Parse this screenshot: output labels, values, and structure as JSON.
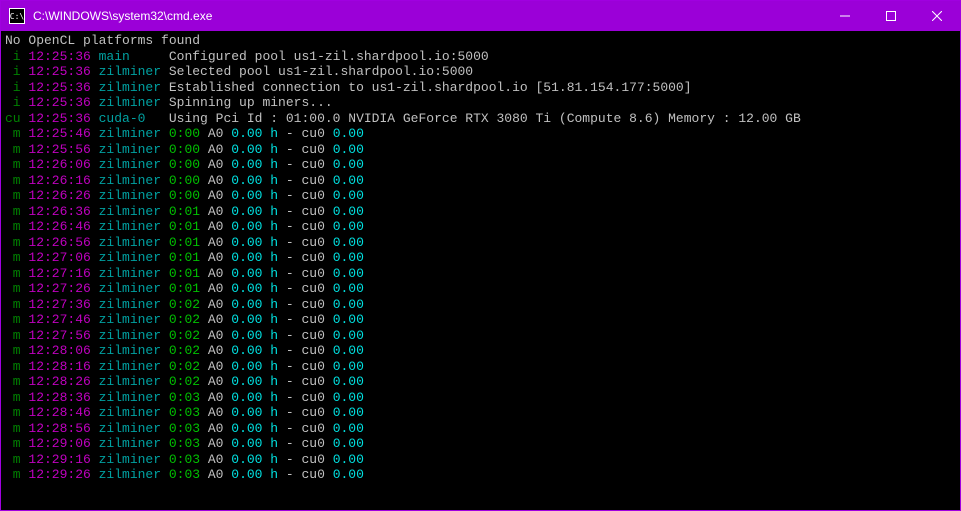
{
  "window": {
    "title": "C:\\WINDOWS\\system32\\cmd.exe",
    "icon_label": "C:\\"
  },
  "intro_line": "No OpenCL platforms found",
  "header_lines": [
    {
      "tag": "i",
      "time": "12:25:36",
      "source": "main",
      "text": "Configured pool us1-zil.shardpool.io:5000"
    },
    {
      "tag": "i",
      "time": "12:25:36",
      "source": "zilminer",
      "text": "Selected pool us1-zil.shardpool.io:5000"
    },
    {
      "tag": "i",
      "time": "12:25:36",
      "source": "zilminer",
      "text": "Established connection to us1-zil.shardpool.io [51.81.154.177:5000]"
    },
    {
      "tag": "i",
      "time": "12:25:36",
      "source": "zilminer",
      "text": "Spinning up miners..."
    }
  ],
  "cuda_line": {
    "tag": "cu",
    "time": "12:25:36",
    "source": "cuda-0",
    "text": "Using Pci Id : 01:00.0 NVIDIA GeForce RTX 3080 Ti (Compute 8.6) Memory : 12.00 GB"
  },
  "miner_lines": [
    {
      "tag": "m",
      "time": "12:25:46",
      "source": "zilminer",
      "elapsed": "0:00",
      "a": "A0",
      "rate": "0.00 h",
      "sep": "-",
      "dev": "cu0",
      "devrate": "0.00"
    },
    {
      "tag": "m",
      "time": "12:25:56",
      "source": "zilminer",
      "elapsed": "0:00",
      "a": "A0",
      "rate": "0.00 h",
      "sep": "-",
      "dev": "cu0",
      "devrate": "0.00"
    },
    {
      "tag": "m",
      "time": "12:26:06",
      "source": "zilminer",
      "elapsed": "0:00",
      "a": "A0",
      "rate": "0.00 h",
      "sep": "-",
      "dev": "cu0",
      "devrate": "0.00"
    },
    {
      "tag": "m",
      "time": "12:26:16",
      "source": "zilminer",
      "elapsed": "0:00",
      "a": "A0",
      "rate": "0.00 h",
      "sep": "-",
      "dev": "cu0",
      "devrate": "0.00"
    },
    {
      "tag": "m",
      "time": "12:26:26",
      "source": "zilminer",
      "elapsed": "0:00",
      "a": "A0",
      "rate": "0.00 h",
      "sep": "-",
      "dev": "cu0",
      "devrate": "0.00"
    },
    {
      "tag": "m",
      "time": "12:26:36",
      "source": "zilminer",
      "elapsed": "0:01",
      "a": "A0",
      "rate": "0.00 h",
      "sep": "-",
      "dev": "cu0",
      "devrate": "0.00"
    },
    {
      "tag": "m",
      "time": "12:26:46",
      "source": "zilminer",
      "elapsed": "0:01",
      "a": "A0",
      "rate": "0.00 h",
      "sep": "-",
      "dev": "cu0",
      "devrate": "0.00"
    },
    {
      "tag": "m",
      "time": "12:26:56",
      "source": "zilminer",
      "elapsed": "0:01",
      "a": "A0",
      "rate": "0.00 h",
      "sep": "-",
      "dev": "cu0",
      "devrate": "0.00"
    },
    {
      "tag": "m",
      "time": "12:27:06",
      "source": "zilminer",
      "elapsed": "0:01",
      "a": "A0",
      "rate": "0.00 h",
      "sep": "-",
      "dev": "cu0",
      "devrate": "0.00"
    },
    {
      "tag": "m",
      "time": "12:27:16",
      "source": "zilminer",
      "elapsed": "0:01",
      "a": "A0",
      "rate": "0.00 h",
      "sep": "-",
      "dev": "cu0",
      "devrate": "0.00"
    },
    {
      "tag": "m",
      "time": "12:27:26",
      "source": "zilminer",
      "elapsed": "0:01",
      "a": "A0",
      "rate": "0.00 h",
      "sep": "-",
      "dev": "cu0",
      "devrate": "0.00"
    },
    {
      "tag": "m",
      "time": "12:27:36",
      "source": "zilminer",
      "elapsed": "0:02",
      "a": "A0",
      "rate": "0.00 h",
      "sep": "-",
      "dev": "cu0",
      "devrate": "0.00"
    },
    {
      "tag": "m",
      "time": "12:27:46",
      "source": "zilminer",
      "elapsed": "0:02",
      "a": "A0",
      "rate": "0.00 h",
      "sep": "-",
      "dev": "cu0",
      "devrate": "0.00"
    },
    {
      "tag": "m",
      "time": "12:27:56",
      "source": "zilminer",
      "elapsed": "0:02",
      "a": "A0",
      "rate": "0.00 h",
      "sep": "-",
      "dev": "cu0",
      "devrate": "0.00"
    },
    {
      "tag": "m",
      "time": "12:28:06",
      "source": "zilminer",
      "elapsed": "0:02",
      "a": "A0",
      "rate": "0.00 h",
      "sep": "-",
      "dev": "cu0",
      "devrate": "0.00"
    },
    {
      "tag": "m",
      "time": "12:28:16",
      "source": "zilminer",
      "elapsed": "0:02",
      "a": "A0",
      "rate": "0.00 h",
      "sep": "-",
      "dev": "cu0",
      "devrate": "0.00"
    },
    {
      "tag": "m",
      "time": "12:28:26",
      "source": "zilminer",
      "elapsed": "0:02",
      "a": "A0",
      "rate": "0.00 h",
      "sep": "-",
      "dev": "cu0",
      "devrate": "0.00"
    },
    {
      "tag": "m",
      "time": "12:28:36",
      "source": "zilminer",
      "elapsed": "0:03",
      "a": "A0",
      "rate": "0.00 h",
      "sep": "-",
      "dev": "cu0",
      "devrate": "0.00"
    },
    {
      "tag": "m",
      "time": "12:28:46",
      "source": "zilminer",
      "elapsed": "0:03",
      "a": "A0",
      "rate": "0.00 h",
      "sep": "-",
      "dev": "cu0",
      "devrate": "0.00"
    },
    {
      "tag": "m",
      "time": "12:28:56",
      "source": "zilminer",
      "elapsed": "0:03",
      "a": "A0",
      "rate": "0.00 h",
      "sep": "-",
      "dev": "cu0",
      "devrate": "0.00"
    },
    {
      "tag": "m",
      "time": "12:29:06",
      "source": "zilminer",
      "elapsed": "0:03",
      "a": "A0",
      "rate": "0.00 h",
      "sep": "-",
      "dev": "cu0",
      "devrate": "0.00"
    },
    {
      "tag": "m",
      "time": "12:29:16",
      "source": "zilminer",
      "elapsed": "0:03",
      "a": "A0",
      "rate": "0.00 h",
      "sep": "-",
      "dev": "cu0",
      "devrate": "0.00"
    },
    {
      "tag": "m",
      "time": "12:29:26",
      "source": "zilminer",
      "elapsed": "0:03",
      "a": "A0",
      "rate": "0.00 h",
      "sep": "-",
      "dev": "cu0",
      "devrate": "0.00"
    }
  ]
}
